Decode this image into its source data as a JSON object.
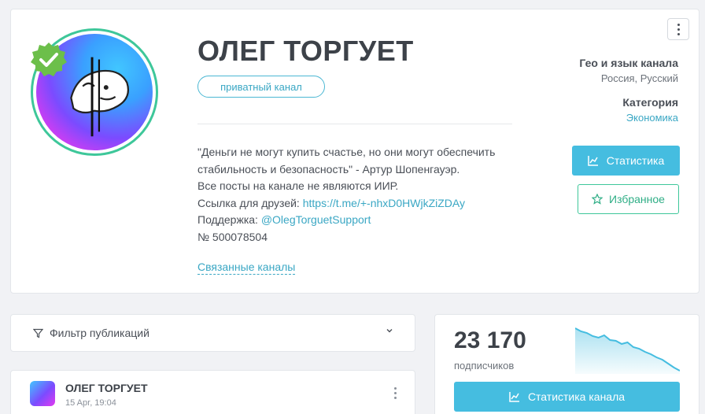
{
  "channel": {
    "title": "ОЛЕГ ТОРГУЕТ",
    "badge": "приватный канал",
    "description": {
      "line1": "\"Деньги не могут купить счастье, но они могут обеспечить",
      "line2": "стабильность и безопасность\" - Артур Шопенгауэр.",
      "line3": "Все посты на канале не являются ИИР.",
      "link_prefix": "Ссылка для друзей: ",
      "link": "https://t.me/+-nhxD0HWjkZiZDAy",
      "support_prefix": "Поддержка: ",
      "support": "@OlegTorguetSupport",
      "number": "№ 500078504"
    },
    "related": "Связанные каналы",
    "geo_label": "Гео и язык канала",
    "geo_value": "Россия, Русский",
    "category_label": "Категория",
    "category_value": "Экономика",
    "stats_button": "Статистика",
    "favorite_button": "Избранное"
  },
  "filter": {
    "label": "Фильтр публикаций"
  },
  "post": {
    "title": "ОЛЕГ ТОРГУЕТ",
    "date": "15 Apr, 19:04"
  },
  "subscribers": {
    "count": "23 170",
    "label": "подписчиков",
    "button": "Статистика канала",
    "trend": [
      100,
      96,
      94,
      90,
      88,
      91,
      85,
      84,
      80,
      82,
      76,
      74,
      70,
      67,
      63,
      60,
      55,
      50,
      46
    ]
  },
  "icons": [
    "verified-icon",
    "chart-icon",
    "star-icon",
    "filter-icon",
    "chevron-down-icon",
    "more-vertical-icon"
  ],
  "colors": {
    "accent": "#45bde0",
    "green": "#3ec79a",
    "link": "#3aa7c4"
  }
}
